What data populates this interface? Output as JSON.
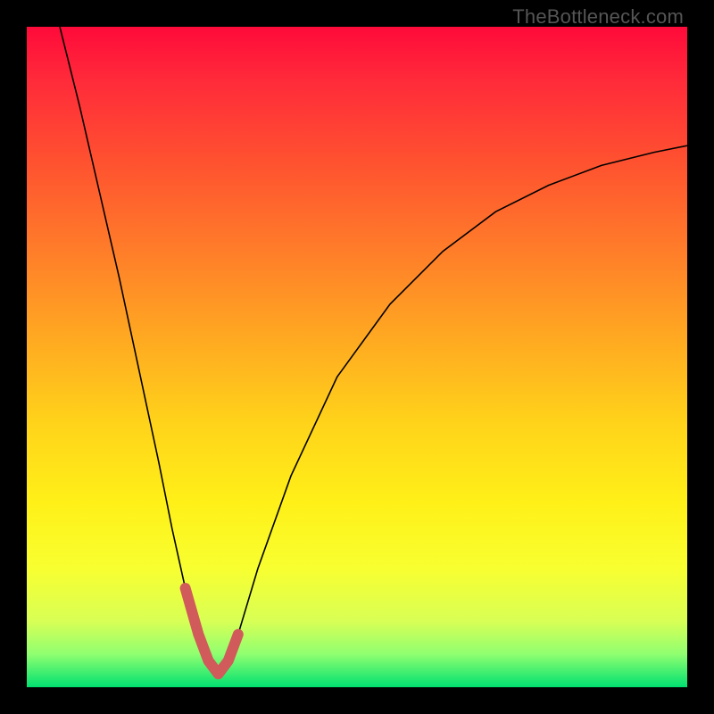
{
  "watermark": "TheBottleneck.com",
  "chart_data": {
    "type": "line",
    "title": "",
    "xlabel": "",
    "ylabel": "",
    "ylim": [
      0,
      100
    ],
    "xlim": [
      0,
      100
    ],
    "series": [
      {
        "name": "bottleneck-curve",
        "x": [
          5,
          8,
          11,
          14,
          17,
          20,
          22,
          24,
          26,
          27.5,
          29,
          30.5,
          32,
          35,
          40,
          47,
          55,
          63,
          71,
          79,
          87,
          95,
          100
        ],
        "y": [
          100,
          88,
          75,
          62,
          48,
          34,
          24,
          15,
          8,
          4,
          2,
          4,
          8,
          18,
          32,
          47,
          58,
          66,
          72,
          76,
          79,
          81,
          82
        ]
      }
    ],
    "highlight": {
      "name": "optimal-range",
      "x": [
        24,
        26,
        27.5,
        29,
        30.5,
        32
      ],
      "y": [
        15,
        8,
        4,
        2,
        4,
        8
      ]
    }
  }
}
